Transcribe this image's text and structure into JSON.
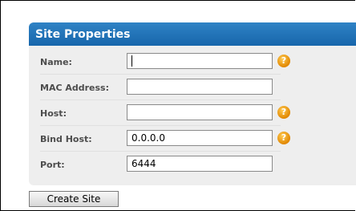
{
  "panel": {
    "title": "Site Properties"
  },
  "fields": [
    {
      "label": "Name:",
      "value": "",
      "help": true,
      "focused": true
    },
    {
      "label": "MAC Address:",
      "value": "",
      "help": false
    },
    {
      "label": "Host:",
      "value": "",
      "help": true
    },
    {
      "label": "Bind Host:",
      "value": "0.0.0.0",
      "help": true
    },
    {
      "label": "Port:",
      "value": "6444",
      "help": false
    }
  ],
  "help_icon": {
    "icon": "question-help-icon",
    "glyph": "?",
    "color": "#e18700"
  },
  "buttons": {
    "create_label": "Create Site"
  },
  "colors": {
    "header": "#1f72b8",
    "panel_bg": "#eeeeee"
  }
}
